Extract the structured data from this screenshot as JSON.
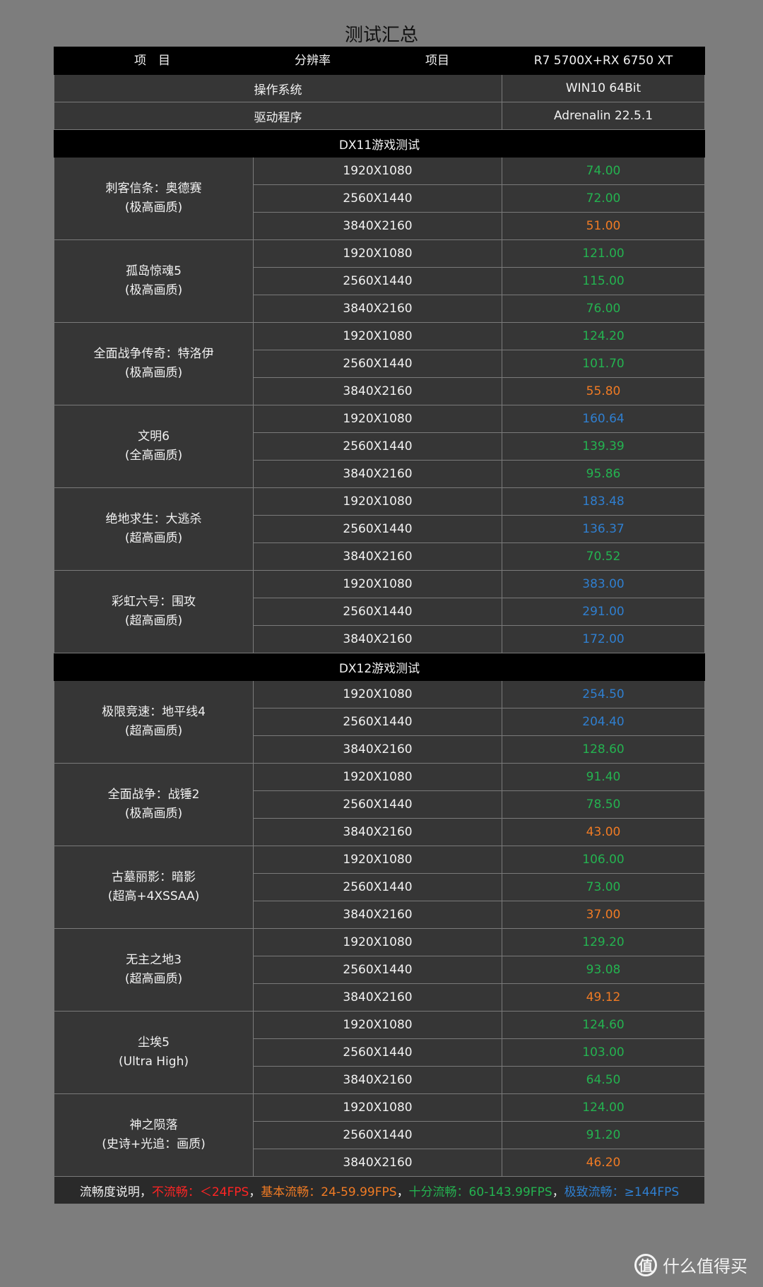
{
  "title": "测试汇总",
  "header": {
    "col_item": "项　目",
    "col_res": "分辨率",
    "col_item2": "项目",
    "col_config": "R7 5700X+RX 6750 XT"
  },
  "info_rows": [
    {
      "label": "操作系统",
      "value": "WIN10 64Bit"
    },
    {
      "label": "驱动程序",
      "value": "Adrenalin 22.5.1"
    }
  ],
  "sections": [
    {
      "title": "DX11游戏测试",
      "games": [
        {
          "name": "刺客信条：奥德赛",
          "setting": "(极高画质)",
          "rows": [
            {
              "res": "1920X1080",
              "fps": "74.00",
              "tier": "green"
            },
            {
              "res": "2560X1440",
              "fps": "72.00",
              "tier": "green"
            },
            {
              "res": "3840X2160",
              "fps": "51.00",
              "tier": "orange"
            }
          ]
        },
        {
          "name": "孤岛惊魂5",
          "setting": "(极高画质)",
          "rows": [
            {
              "res": "1920X1080",
              "fps": "121.00",
              "tier": "green"
            },
            {
              "res": "2560X1440",
              "fps": "115.00",
              "tier": "green"
            },
            {
              "res": "3840X2160",
              "fps": "76.00",
              "tier": "green"
            }
          ]
        },
        {
          "name": "全面战争传奇：特洛伊",
          "setting": "(极高画质)",
          "rows": [
            {
              "res": "1920X1080",
              "fps": "124.20",
              "tier": "green"
            },
            {
              "res": "2560X1440",
              "fps": "101.70",
              "tier": "green"
            },
            {
              "res": "3840X2160",
              "fps": "55.80",
              "tier": "orange"
            }
          ]
        },
        {
          "name": "文明6",
          "setting": "(全高画质)",
          "rows": [
            {
              "res": "1920X1080",
              "fps": "160.64",
              "tier": "blue"
            },
            {
              "res": "2560X1440",
              "fps": "139.39",
              "tier": "green"
            },
            {
              "res": "3840X2160",
              "fps": "95.86",
              "tier": "green"
            }
          ]
        },
        {
          "name": "绝地求生：大逃杀",
          "setting": "(超高画质)",
          "rows": [
            {
              "res": "1920X1080",
              "fps": "183.48",
              "tier": "blue"
            },
            {
              "res": "2560X1440",
              "fps": "136.37",
              "tier": "blue"
            },
            {
              "res": "3840X2160",
              "fps": "70.52",
              "tier": "green"
            }
          ]
        },
        {
          "name": "彩虹六号：围攻",
          "setting": "(超高画质)",
          "rows": [
            {
              "res": "1920X1080",
              "fps": "383.00",
              "tier": "blue"
            },
            {
              "res": "2560X1440",
              "fps": "291.00",
              "tier": "blue"
            },
            {
              "res": "3840X2160",
              "fps": "172.00",
              "tier": "blue"
            }
          ]
        }
      ]
    },
    {
      "title": "DX12游戏测试",
      "games": [
        {
          "name": "极限竞速：地平线4",
          "setting": "(超高画质)",
          "rows": [
            {
              "res": "1920X1080",
              "fps": "254.50",
              "tier": "blue"
            },
            {
              "res": "2560X1440",
              "fps": "204.40",
              "tier": "blue"
            },
            {
              "res": "3840X2160",
              "fps": "128.60",
              "tier": "green"
            }
          ]
        },
        {
          "name": "全面战争：战锤2",
          "setting": "(极高画质)",
          "rows": [
            {
              "res": "1920X1080",
              "fps": "91.40",
              "tier": "green"
            },
            {
              "res": "2560X1440",
              "fps": "78.50",
              "tier": "green"
            },
            {
              "res": "3840X2160",
              "fps": "43.00",
              "tier": "orange"
            }
          ]
        },
        {
          "name": "古墓丽影：暗影",
          "setting": "(超高+4XSSAA)",
          "rows": [
            {
              "res": "1920X1080",
              "fps": "106.00",
              "tier": "green"
            },
            {
              "res": "2560X1440",
              "fps": "73.00",
              "tier": "green"
            },
            {
              "res": "3840X2160",
              "fps": "37.00",
              "tier": "orange"
            }
          ]
        },
        {
          "name": "无主之地3",
          "setting": "(超高画质)",
          "rows": [
            {
              "res": "1920X1080",
              "fps": "129.20",
              "tier": "green"
            },
            {
              "res": "2560X1440",
              "fps": "93.08",
              "tier": "green"
            },
            {
              "res": "3840X2160",
              "fps": "49.12",
              "tier": "orange"
            }
          ]
        },
        {
          "name": "尘埃5",
          "setting": "(Ultra High)",
          "rows": [
            {
              "res": "1920X1080",
              "fps": "124.60",
              "tier": "green"
            },
            {
              "res": "2560X1440",
              "fps": "103.00",
              "tier": "green"
            },
            {
              "res": "3840X2160",
              "fps": "64.50",
              "tier": "green"
            }
          ]
        },
        {
          "name": "神之陨落",
          "setting": "(史诗+光追：画质)",
          "rows": [
            {
              "res": "1920X1080",
              "fps": "124.00",
              "tier": "green"
            },
            {
              "res": "2560X1440",
              "fps": "91.20",
              "tier": "green"
            },
            {
              "res": "3840X2160",
              "fps": "46.20",
              "tier": "orange"
            }
          ]
        }
      ]
    }
  ],
  "legend": {
    "prefix": "流畅度说明，",
    "items": [
      {
        "text": "不流畅：＜24FPS",
        "tier": "red"
      },
      {
        "text": "，",
        "tier": "white"
      },
      {
        "text": "基本流畅：24-59.99FPS",
        "tier": "orange"
      },
      {
        "text": "，",
        "tier": "white"
      },
      {
        "text": "十分流畅：60-143.99FPS",
        "tier": "green"
      },
      {
        "text": "，",
        "tier": "white"
      },
      {
        "text": "极致流畅：≥144FPS",
        "tier": "blue"
      }
    ]
  },
  "watermark": {
    "logo": "值",
    "text": "什么值得买"
  },
  "colors": {
    "green": "#24b350",
    "orange": "#f07b24",
    "blue": "#2f7fd0",
    "red": "#ff2424",
    "header_bg": "#000000",
    "cell_bg": "#363636",
    "page_bg": "#7d7d7d"
  }
}
